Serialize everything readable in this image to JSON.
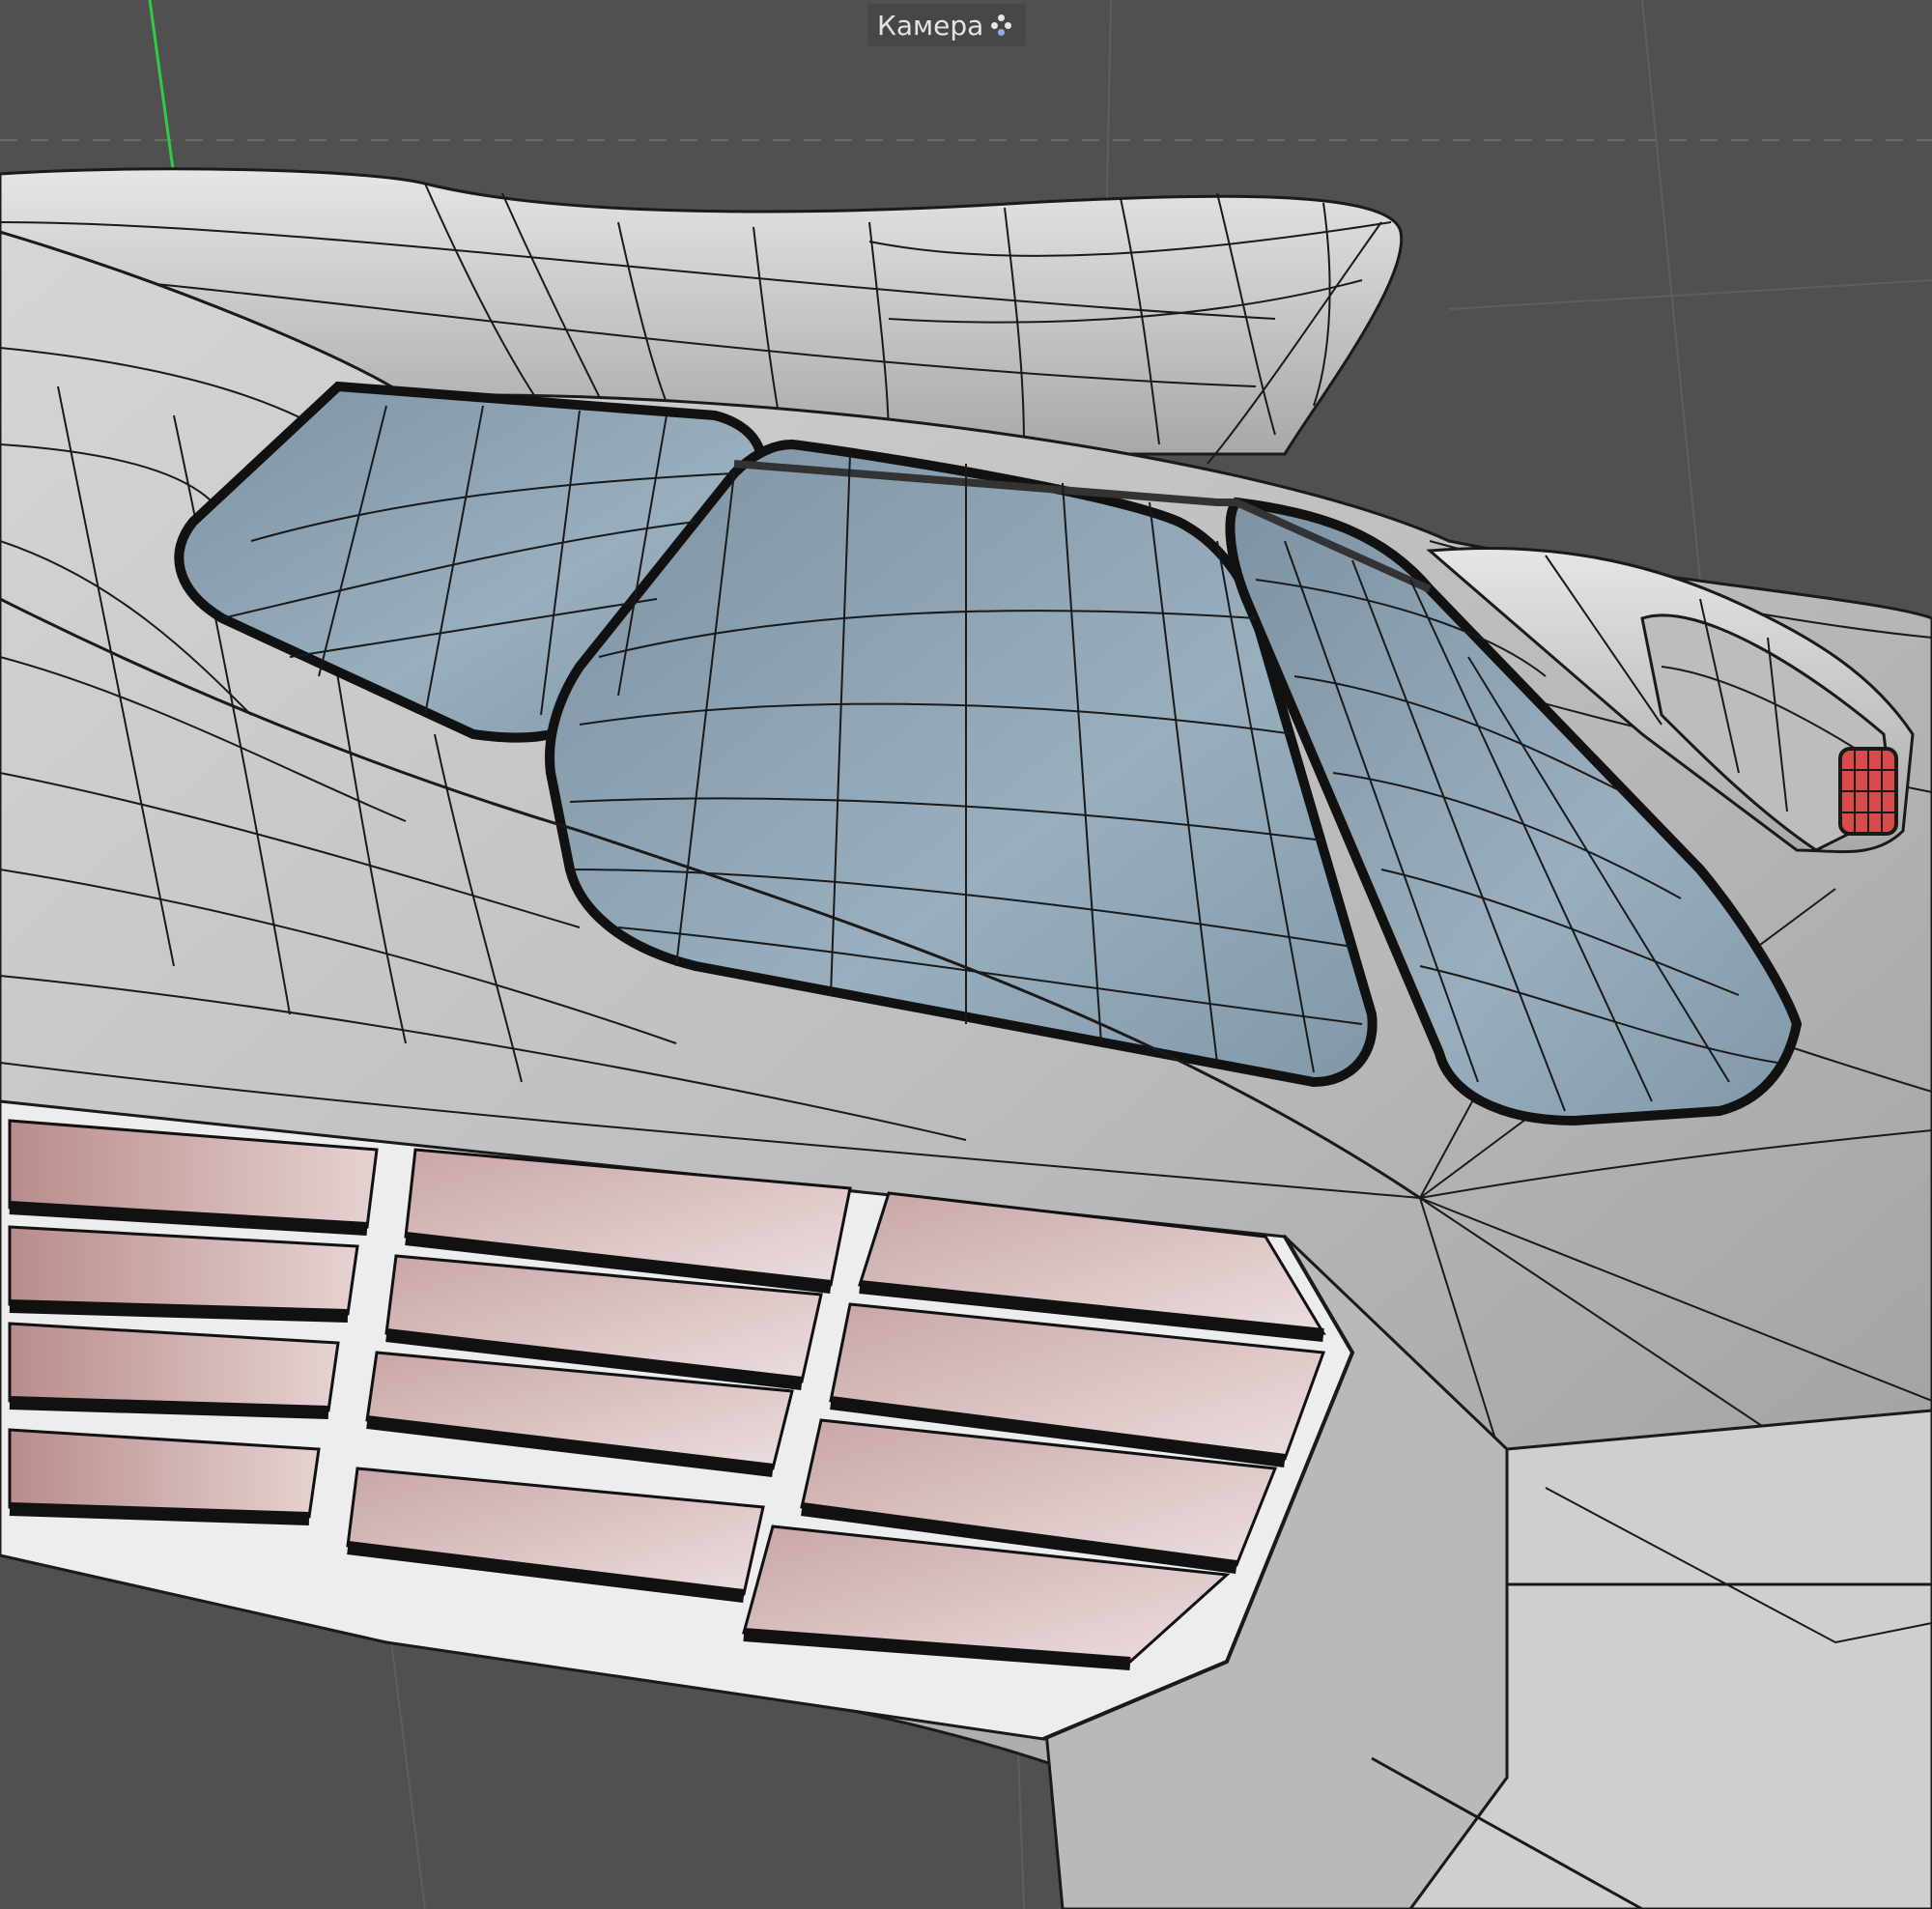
{
  "viewport": {
    "camera_label": "Камера",
    "camera_icon": "camera-mode-icon"
  },
  "colors": {
    "background": "#505050",
    "grid_line": "#5e5e5e",
    "y_axis": "#2ecc40",
    "hull": "#c8c8c8",
    "canopy_glass": "#8fa5b4",
    "panel_pink": "#d9c3c3",
    "nozzle_red": "#d94a4a",
    "wire": "#1a1a1a"
  }
}
